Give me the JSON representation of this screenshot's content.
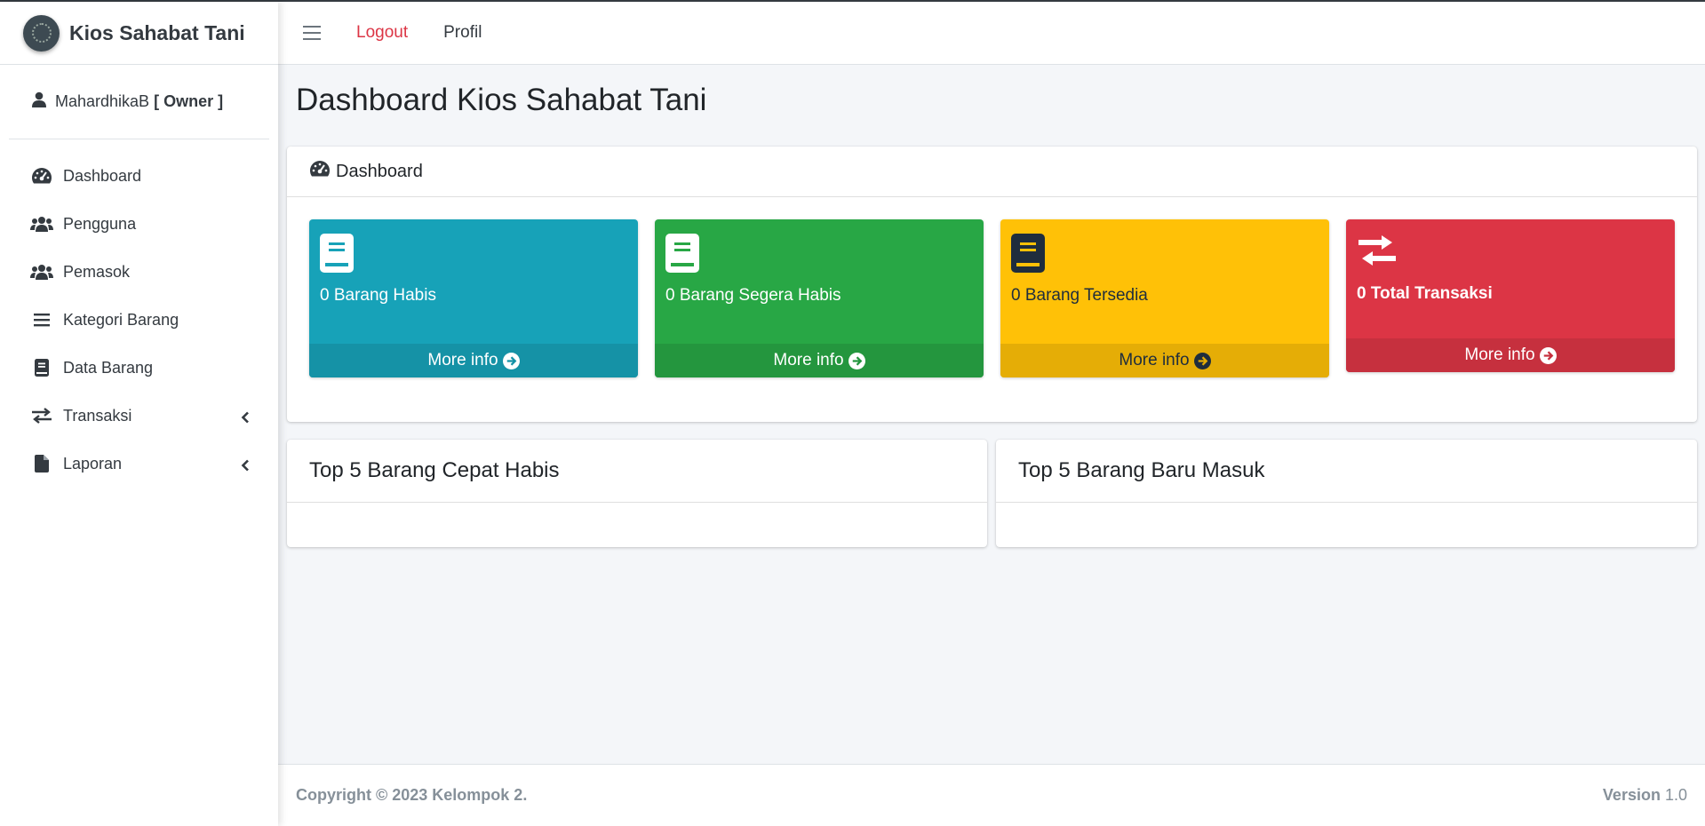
{
  "brand": {
    "name": "Kios Sahabat Tani"
  },
  "user": {
    "name": "MahardhikaB",
    "role": "[ Owner ]"
  },
  "sidebar": {
    "items": [
      {
        "label": "Dashboard",
        "icon": "tachometer-icon"
      },
      {
        "label": "Pengguna",
        "icon": "users-icon"
      },
      {
        "label": "Pemasok",
        "icon": "users-icon"
      },
      {
        "label": "Kategori Barang",
        "icon": "list-icon"
      },
      {
        "label": "Data Barang",
        "icon": "book-icon"
      },
      {
        "label": "Transaksi",
        "icon": "exchange-icon",
        "has_submenu": true
      },
      {
        "label": "Laporan",
        "icon": "file-icon",
        "has_submenu": true
      }
    ]
  },
  "topbar": {
    "logout": "Logout",
    "profile": "Profil"
  },
  "main": {
    "page_title": "Dashboard Kios Sahabat Tani",
    "dashboard_card_title": "Dashboard",
    "boxes": [
      {
        "label": "0 Barang Habis",
        "footer": "More info",
        "color": "#17a2b8"
      },
      {
        "label": "0 Barang Segera Habis",
        "footer": "More info",
        "color": "#28a745"
      },
      {
        "label": "0 Barang Tersedia",
        "footer": "More info",
        "color": "#ffc107"
      },
      {
        "label": "0 Total Transaksi",
        "footer": "More info",
        "color": "#dc3545"
      }
    ],
    "top_cards": [
      {
        "title": "Top 5 Barang Cepat Habis"
      },
      {
        "title": "Top 5 Barang Baru Masuk"
      }
    ]
  },
  "footer": {
    "copyright": "Copyright © 2023 Kelompok 2.",
    "version_label": "Version",
    "version_number": "1.0"
  }
}
